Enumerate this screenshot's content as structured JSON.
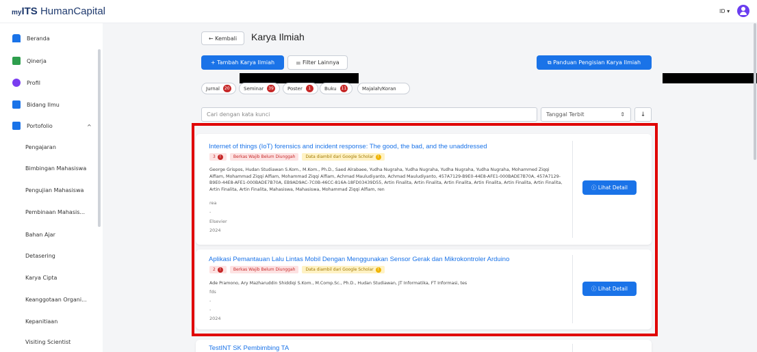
{
  "header": {
    "logo_my": "my",
    "logo_its": "ITS",
    "logo_hc": " HumanCapital",
    "lang": "ID ▾"
  },
  "sidebar": {
    "items": [
      {
        "label": "Beranda",
        "icon": "home-icon",
        "color": "#1a73e8"
      },
      {
        "label": "Qinerja",
        "icon": "qinerja-icon",
        "color": "#2e9e4d"
      },
      {
        "label": "Profil",
        "icon": "profile-icon",
        "color": "#7a3df0"
      },
      {
        "label": "Bidang Ilmu",
        "icon": "book-icon",
        "color": "#1a73e8"
      },
      {
        "label": "Portofolio",
        "icon": "portfolio-icon",
        "color": "#1a73e8"
      }
    ],
    "chevron": "^",
    "subitems": [
      "Pengajaran",
      "Bimbingan Mahasiswa",
      "Pengujian Mahasiswa",
      "Pembinaan Mahasis...",
      "Bahan Ajar",
      "Detasering",
      "Karya Cipta",
      "Keanggotaan Organi...",
      "Kepanitiaan",
      "Visiting Scientist"
    ]
  },
  "main": {
    "back_label": "← Kembali",
    "title": "Karya Ilmiah",
    "add_label": "+  Tambah Karya Ilmiah",
    "filter_label": "⚌  Filter Lainnya",
    "guide_label": "⧉  Panduan Pengisian Karya Ilmiah",
    "chips": [
      {
        "label": "Jurnal",
        "count": "20"
      },
      {
        "label": "Seminar",
        "count": "39"
      },
      {
        "label": "Poster",
        "count": "1"
      },
      {
        "label": "Buku",
        "count": "11"
      },
      {
        "label": "Majalah/Koran",
        "count": ""
      }
    ],
    "search_placeholder": "Cari dengan kata kunci",
    "sort_value": "Tanggal Terbit",
    "sort_arrows": "⇕",
    "sort_dir": "↓"
  },
  "cards": [
    {
      "title": "Internet of things (IoT) forensics and incident response: The good, the bad, and the unaddressed",
      "badge_count": "3",
      "badge_missing": "Berkas Wajib Belum Diunggah",
      "badge_scholar": "Data diambil dari Google Scholar",
      "authors": "George Grispos, Hudan Studiawan S.Kom., M.Kom., Ph.D., Saed Alrabaee, Yudha Nugraha, Yudha Nugraha, Yudha Nugraha, Yudha Nugraha, Mohammed Ziqqi Alfiam, Mohammad Ziqqi Alfiam, Mohammad Ziqqi Alfiam, Achmad Mauludiyanto, Achmad Mauludiyanto, 457A7129-B9E0-44E8-AFE1-000BADE7B70A, 457A7129-B9E0-44E8-AFE1-000BADE7B70A, EB9AD9AC-7C0B-46CC-816A-18FD03439D55, Artin Finalita, Artin Finalita, Artin Finalita, Artin Finalita, Artin Finalita, Artin Finalita, Artin Finalita, Artin Finalita, Mahasiswa, Mahasiswa, Mohammad Ziqqi Alfiam, ren",
      "line1": "rea",
      "line2": "-",
      "line3": "Elsevier",
      "year": "2024",
      "detail_label": "ⓘ  Lihat Detail"
    },
    {
      "title": "Aplikasi Pemantauan Lalu Lintas Mobil Dengan Menggunakan Sensor Gerak dan Mikrokontroler Arduino",
      "badge_count": "2",
      "badge_missing": "Berkas Wajib Belum Diunggah",
      "badge_scholar": "Data diambil dari Google Scholar",
      "authors": "Ade Pramono, Ary Mazharuddin Shiddiqi S.Kom., M.Comp.Sc., Ph.D., Hudan Studiawan, JT Informatika, FT Informasi, tes",
      "line1": "fds",
      "line2": "-",
      "line3": "-",
      "year": "2024",
      "detail_label": "ⓘ  Lihat Detail"
    },
    {
      "title": "TestINT SK Pembimbing TA"
    }
  ]
}
